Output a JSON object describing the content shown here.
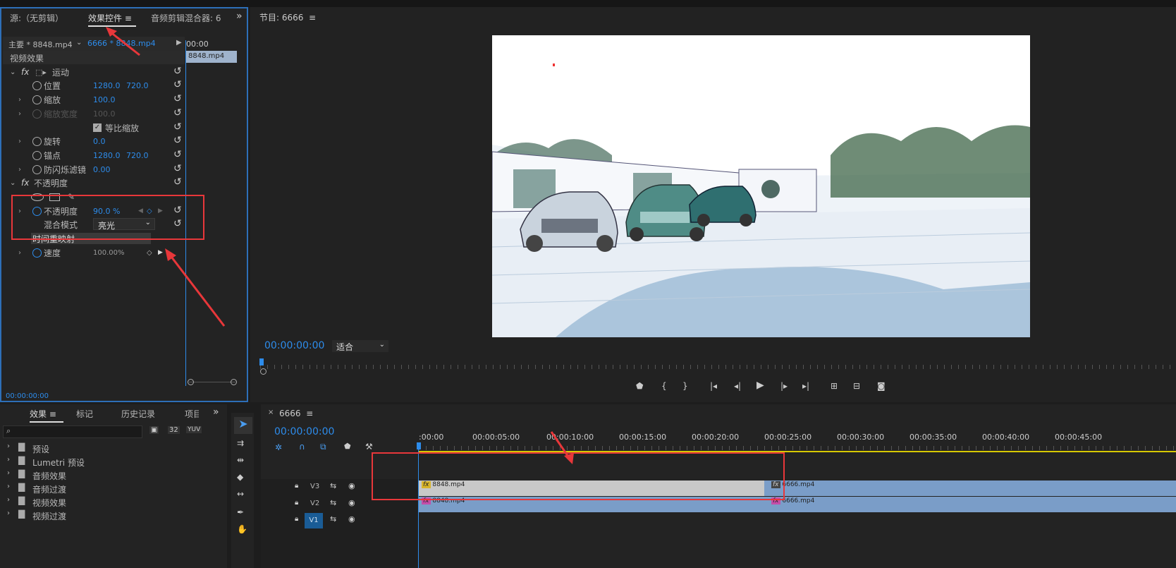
{
  "left_panel": {
    "tabs": [
      "源:（无剪辑）",
      "效果控件",
      "音频剪辑混合器: 6"
    ],
    "master_label": "主要 * 8848.mp4",
    "clip_label": "6666 * 8848.mp4",
    "mini_time": "00:00",
    "mini_clip": "8848.mp4",
    "section": "视频效果",
    "footer_time": "00:00:00:00",
    "rows": [
      {
        "label": "运动",
        "fx": true
      },
      {
        "label": "位置",
        "v1": "1280.0",
        "v2": "720.0"
      },
      {
        "label": "缩放",
        "v1": "100.0"
      },
      {
        "label": "缩放宽度",
        "v1": "100.0",
        "disabled": true
      },
      {
        "label": "等比缩放",
        "checkbox": true
      },
      {
        "label": "旋转",
        "v1": "0.0"
      },
      {
        "label": "锚点",
        "v1": "1280.0",
        "v2": "720.0"
      },
      {
        "label": "防闪烁滤镜",
        "v1": "0.00"
      },
      {
        "label": "不透明度",
        "fx": true
      },
      {
        "label": "不透明度",
        "v1": "90.0 %"
      },
      {
        "label": "混合模式",
        "select": "亮光"
      },
      {
        "label": "时间重映射",
        "fx": true
      },
      {
        "label": "速度",
        "v1": "100.00%"
      }
    ]
  },
  "program": {
    "title": "节目: 6666",
    "timecode": "00:00:00:00",
    "fit": "适合"
  },
  "effects_panel": {
    "tabs": [
      "效果",
      "标记",
      "历史记录",
      "项目"
    ],
    "items": [
      "预设",
      "Lumetri 预设",
      "音频效果",
      "音频过渡",
      "视频效果",
      "视频过渡"
    ],
    "badge32": "32",
    "badge_yuv": "YUV"
  },
  "timeline": {
    "title": "6666",
    "timecode": "00:00:00:00",
    "ticks": [
      ":00:00",
      "00:00:05:00",
      "00:00:10:00",
      "00:00:15:00",
      "00:00:20:00",
      "00:00:25:00",
      "00:00:30:00",
      "00:00:35:00",
      "00:00:40:00",
      "00:00:45:00"
    ],
    "tracks": [
      "V3",
      "V2",
      "V1"
    ],
    "clips": {
      "v3a": "8848.mp4",
      "v3b": "6666.mp4",
      "v2a": "8848.mp4",
      "v2b": "6666.mp4"
    },
    "fx_badge": "fx"
  },
  "colors": {
    "accent": "#2d8ceb",
    "annotation_red": "#e8373a",
    "clip_gray": "#c8c8c8",
    "clip_blue": "#7a9dc8"
  }
}
